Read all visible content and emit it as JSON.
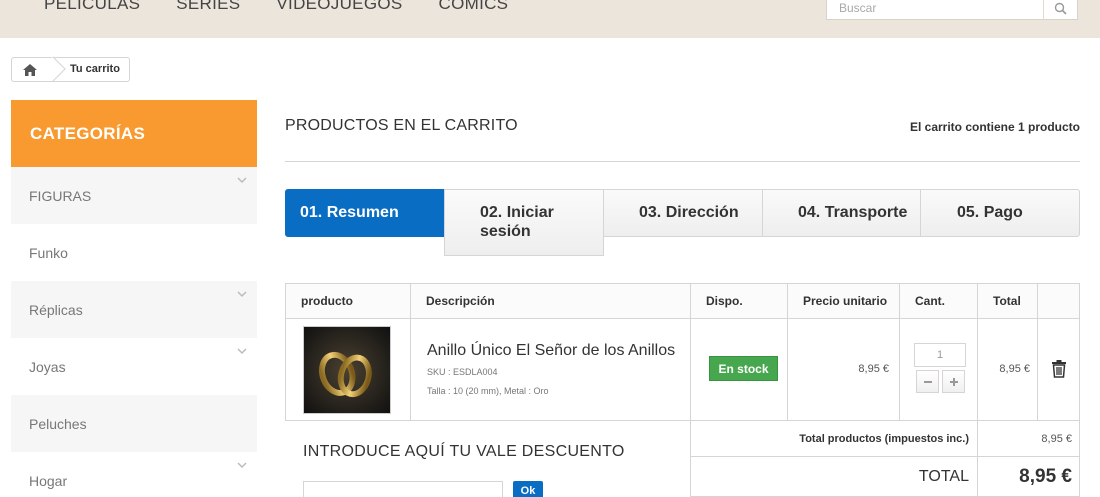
{
  "nav": {
    "items": [
      "PELÍCULAS",
      "SERIES",
      "VIDEOJUEGOS",
      "CÓMICS"
    ],
    "search_placeholder": "Buscar"
  },
  "breadcrumb": {
    "current": "Tu carrito"
  },
  "sidebar": {
    "title": "CATEGORÍAS",
    "items": [
      {
        "label": "FIGURAS",
        "expandable": true
      },
      {
        "label": "Funko",
        "expandable": false
      },
      {
        "label": "Réplicas",
        "expandable": true
      },
      {
        "label": "Joyas",
        "expandable": true
      },
      {
        "label": "Peluches",
        "expandable": false
      },
      {
        "label": "Hogar",
        "expandable": true
      }
    ]
  },
  "main": {
    "title": "PRODUCTOS EN EL CARRITO",
    "cart_count": "El carrito contiene 1 producto"
  },
  "steps": [
    {
      "label": "01. Resumen",
      "active": true
    },
    {
      "label": "02. Iniciar sesión",
      "active": false
    },
    {
      "label": "03. Dirección",
      "active": false
    },
    {
      "label": "04. Transporte",
      "active": false
    },
    {
      "label": "05. Pago",
      "active": false
    }
  ],
  "table": {
    "headers": [
      "producto",
      "Descripción",
      "Dispo.",
      "Precio unitario",
      "Cant.",
      "Total"
    ],
    "rows": [
      {
        "name": "Anillo Único El Señor de los Anillos",
        "sku": "SKU : ESDLA004",
        "attributes": "Talla : 10 (20 mm), Metal : Oro",
        "availability": "En stock",
        "unit_price": "8,95 €",
        "quantity": "1",
        "total": "8,95 €"
      }
    ],
    "summary": {
      "products_label": "Total productos (impuestos inc.)",
      "products_value": "8,95 €",
      "total_label": "TOTAL",
      "total_value": "8,95 €"
    }
  },
  "voucher": {
    "title": "INTRODUCE AQUÍ TU VALE DESCUENTO",
    "button": "Ok"
  },
  "colors": {
    "accent_orange": "#f89a30",
    "step_active_blue": "#0a6dc4",
    "stock_green": "#46a74e"
  }
}
